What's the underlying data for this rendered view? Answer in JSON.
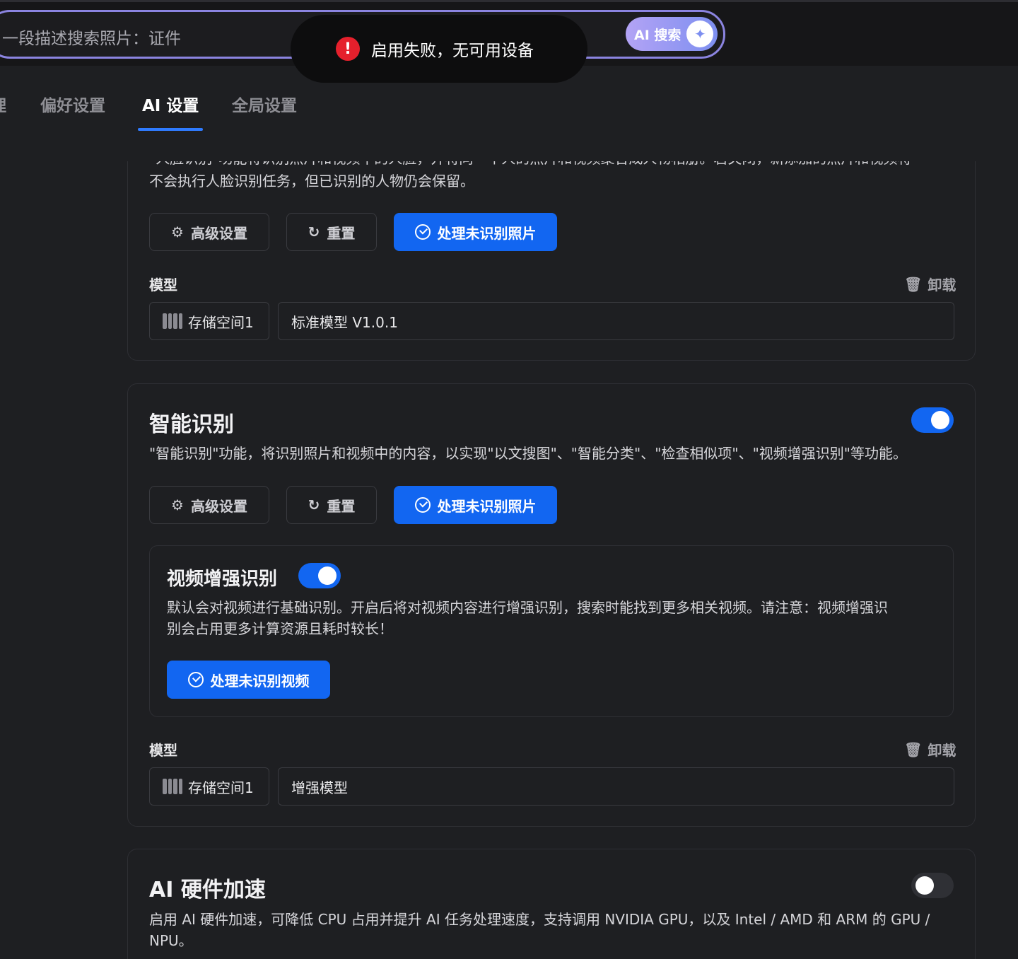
{
  "search": {
    "placeholder": "一段描述搜索照片：证件",
    "ai_button_label": "AI 搜索"
  },
  "toast": {
    "message": "启用失败，无可用设备"
  },
  "tabs": [
    {
      "label": "理"
    },
    {
      "label": "偏好设置"
    },
    {
      "label": "AI 设置"
    },
    {
      "label": "全局设置"
    }
  ],
  "face_card": {
    "desc_top": "\"人脸识别\"功能将识别照片和视频中的人脸，并将同一个人的照片和视频聚合成人物相册。若关闭，新添加的照片和视频将",
    "desc_line2": "不会执行人脸识别任务，但已识别的人物仍会保留。",
    "advanced_label": "高级设置",
    "reset_label": "重置",
    "process_label": "处理未识别照片",
    "model_label": "模型",
    "unload_label": "卸载",
    "storage_label": "存储空间1",
    "model_value": "标准模型 V1.0.1"
  },
  "smart_card": {
    "title": "智能识别",
    "toggle_on": true,
    "desc": "\"智能识别\"功能，将识别照片和视频中的内容，以实现\"以文搜图\"、\"智能分类\"、\"检查相似项\"、\"视频增强识别\"等功能。",
    "advanced_label": "高级设置",
    "reset_label": "重置",
    "process_label": "处理未识别照片",
    "video": {
      "title": "视频增强识别",
      "toggle_on": true,
      "desc_line1": "默认会对视频进行基础识别。开启后将对视频内容进行增强识别，搜索时能找到更多相关视频。请注意：视频增强识",
      "desc_line2": "别会占用更多计算资源且耗时较长！",
      "process_label": "处理未识别视频"
    },
    "model_label": "模型",
    "unload_label": "卸载",
    "storage_label": "存储空间1",
    "model_value": "增强模型"
  },
  "hw_card": {
    "title": "AI 硬件加速",
    "toggle_on": false,
    "desc_line1": "启用 AI 硬件加速，可降低 CPU 占用并提升 AI 任务处理速度，支持调用 NVIDIA GPU，以及 Intel / AMD 和 ARM 的 GPU /",
    "desc_line2": "NPU。"
  },
  "colors": {
    "accent": "#1266f1",
    "toast_error": "#e5202c",
    "search_border": "#8b84e0"
  }
}
